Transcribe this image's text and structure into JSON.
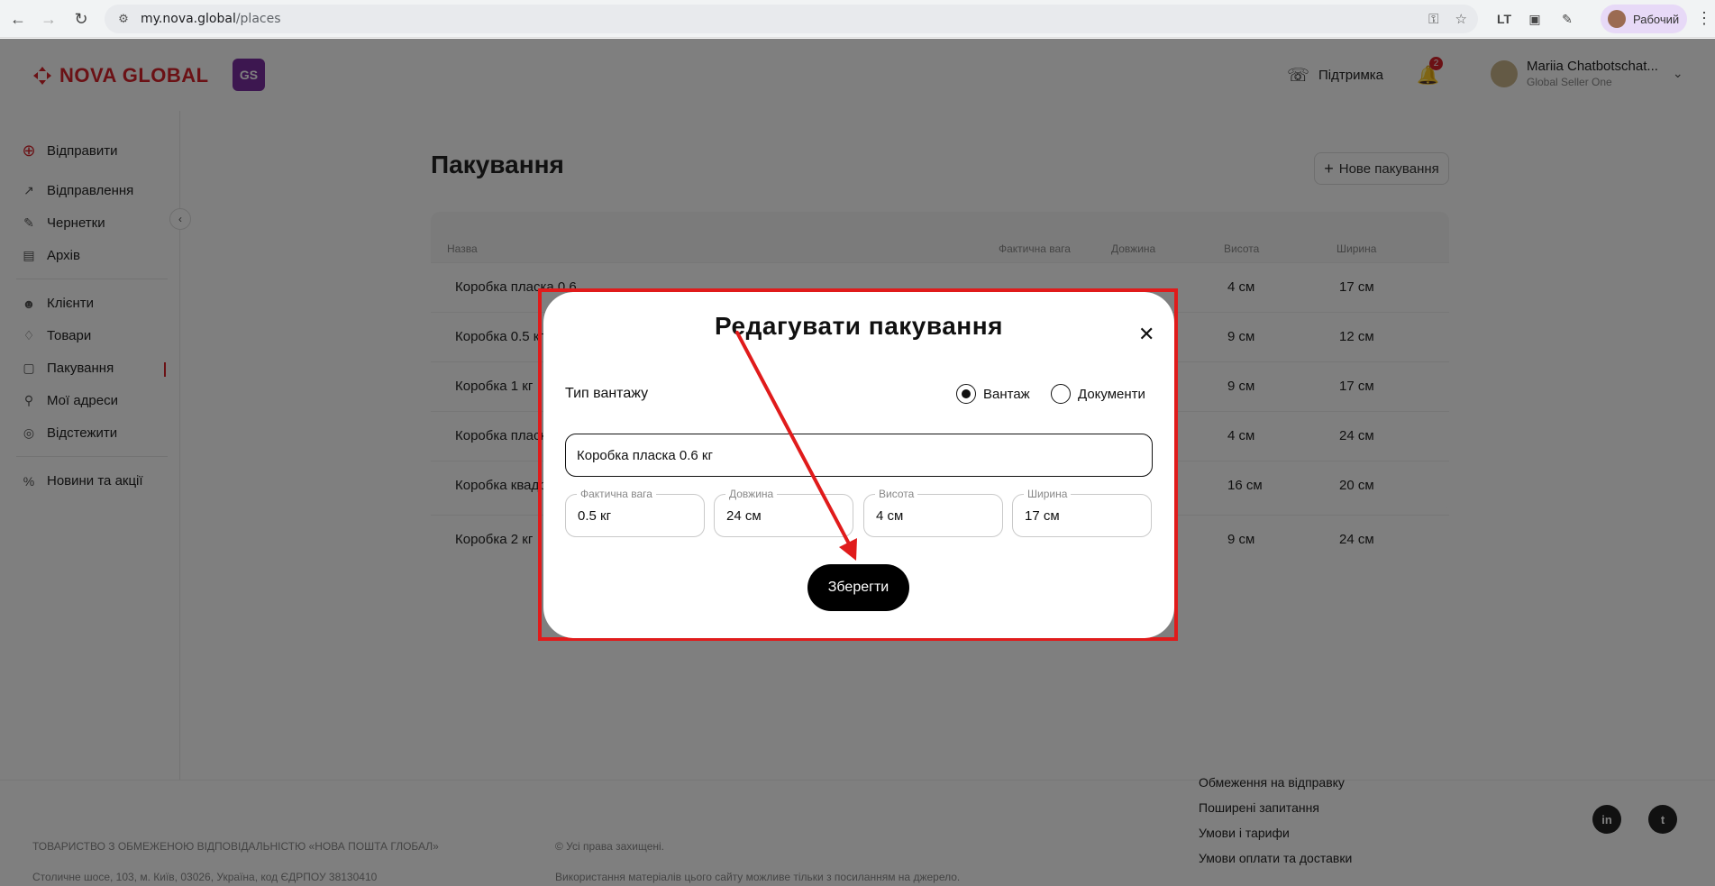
{
  "browser": {
    "url_host": "my.nova.global",
    "url_path": "/places",
    "profile_label": "Рабочий",
    "ext_label": "LT"
  },
  "header": {
    "logo_text": "NOVA GLOBAL",
    "badge_text": "GS",
    "support_label": "Підтримка",
    "notification_count": "2",
    "user_name": "Mariia Chatbotschat...",
    "user_org": "Global Seller One"
  },
  "sidebar": {
    "send_label": "Відправити",
    "items": [
      {
        "label": "Відправлення"
      },
      {
        "label": "Чернетки"
      },
      {
        "label": "Архів"
      },
      {
        "label": "Клієнти"
      },
      {
        "label": "Товари"
      },
      {
        "label": "Пакування"
      },
      {
        "label": "Мої адреси"
      },
      {
        "label": "Відстежити"
      },
      {
        "label": "Новини та акції"
      }
    ]
  },
  "main": {
    "title": "Пакування",
    "new_button": "Нове пакування",
    "columns": [
      "Назва",
      "Фактична вага",
      "Довжина",
      "Висота",
      "Ширина"
    ],
    "rows": [
      {
        "name": "Коробка пласка 0.6",
        "height": "4 см",
        "width": "17 см"
      },
      {
        "name": "Коробка 0.5 кг",
        "height": "9 см",
        "width": "12 см"
      },
      {
        "name": "Коробка 1 кг",
        "height": "9 см",
        "width": "17 см"
      },
      {
        "name": "Коробка пласка",
        "height": "4 см",
        "width": "24 см"
      },
      {
        "name": "Коробка квадр",
        "height": "16 см",
        "width": "20 см"
      },
      {
        "name": "Коробка 2 кг",
        "height": "9 см",
        "width": "24 см"
      }
    ]
  },
  "modal": {
    "title": "Редагувати пакування",
    "cargo_type_label": "Тип вантажу",
    "option_cargo": "Вантаж",
    "option_documents": "Документи",
    "name_value": "Коробка пласка 0.6 кг",
    "fields": [
      {
        "label": "Фактична вага",
        "value": "0.5 кг"
      },
      {
        "label": "Довжина",
        "value": "24 см"
      },
      {
        "label": "Висота",
        "value": "4 см"
      },
      {
        "label": "Ширина",
        "value": "17 см"
      }
    ],
    "save_label": "Зберегти"
  },
  "footer": {
    "company": "ТОВАРИСТВО З ОБМЕЖЕНОЮ ВІДПОВІДАЛЬНІСТЮ «НОВА ПОШТА ГЛОБАЛ»",
    "address": "Столичне шосе, 103, м. Київ, 03026, Україна, код ЄДРПОУ 38130410",
    "rights": "© Усі права захищені.",
    "usage": "Використання матеріалів цього сайту можливе тільки з посиланням на джерело.",
    "links": [
      "Обмеження на відправку",
      "Поширені запитання",
      "Умови і тарифи",
      "Умови оплати та доставки"
    ],
    "social": [
      "in",
      "t"
    ]
  },
  "colors": {
    "brand_red": "#d6232b",
    "annotation_red": "#e01b1b"
  }
}
